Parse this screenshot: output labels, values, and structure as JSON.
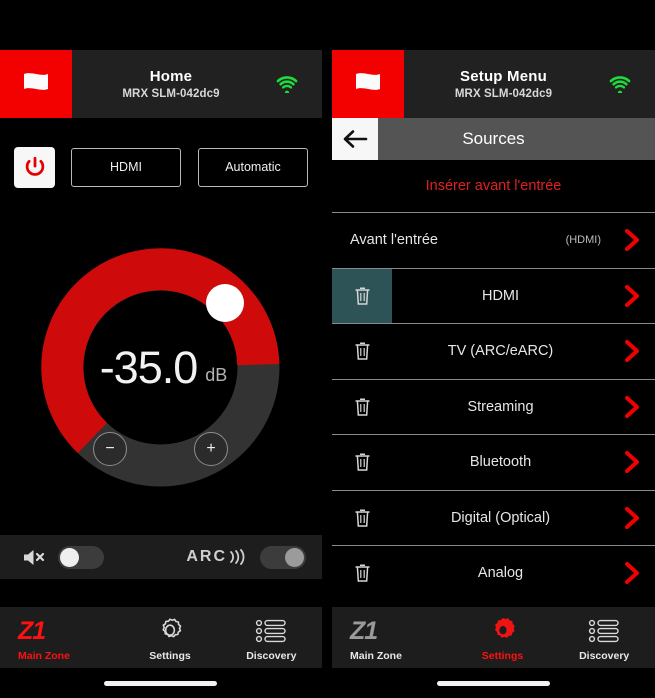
{
  "left": {
    "header": {
      "title": "Home",
      "subtitle": "MRX SLM-042dc9",
      "logo_icon": "flag-icon",
      "wifi_icon": "wifi-icon",
      "wifi_color": "#1ddb3a",
      "brand_color": "#f30000"
    },
    "controls": {
      "power_icon": "power-icon",
      "power_color": "#e40000",
      "source_button": "HDMI",
      "mode_button": "Automatic"
    },
    "dial": {
      "value": "-35.0",
      "unit": "dB",
      "minus_label": "−",
      "plus_label": "+",
      "arc_color": "#cf0a0a",
      "track_color": "#333333",
      "knob_color": "#ffffff",
      "percent": 62
    },
    "audio_bar": {
      "mute_icon": "speaker-mute-icon",
      "mute_state": "off",
      "arc_label": "ARC",
      "arc_icon": "arc-waves-icon",
      "arc_state": "on"
    },
    "tabs": [
      {
        "name": "zone",
        "icon": "z1-logo",
        "glyph": "Z1",
        "label": "Main Zone",
        "active": true
      },
      {
        "name": "settings",
        "icon": "gear-icon",
        "label": "Settings",
        "active": false
      },
      {
        "name": "discovery",
        "icon": "list-icon",
        "label": "Discovery",
        "active": false
      }
    ]
  },
  "right": {
    "header": {
      "title": "Setup Menu",
      "subtitle": "MRX SLM-042dc9",
      "logo_icon": "flag-icon",
      "wifi_icon": "wifi-icon",
      "wifi_color": "#1ddb3a",
      "brand_color": "#f30000"
    },
    "sub_header": {
      "back_icon": "arrow-left-icon",
      "title": "Sources"
    },
    "insert_hint": "Insérer avant l'entrée",
    "list_head": {
      "label": "Avant l'entrée",
      "tag": "(HDMI)",
      "chevron_icon": "chevron-right-icon"
    },
    "sources": [
      {
        "label": "HDMI",
        "trash_icon": "trash-icon",
        "trash_highlight": true,
        "chevron_icon": "chevron-right-icon"
      },
      {
        "label": "TV (ARC/eARC)",
        "trash_icon": "trash-icon",
        "trash_highlight": false,
        "chevron_icon": "chevron-right-icon"
      },
      {
        "label": "Streaming",
        "trash_icon": "trash-icon",
        "trash_highlight": false,
        "chevron_icon": "chevron-right-icon"
      },
      {
        "label": "Bluetooth",
        "trash_icon": "trash-icon",
        "trash_highlight": false,
        "chevron_icon": "chevron-right-icon"
      },
      {
        "label": "Digital (Optical)",
        "trash_icon": "trash-icon",
        "trash_highlight": false,
        "chevron_icon": "chevron-right-icon"
      },
      {
        "label": "Analog",
        "trash_icon": "trash-icon",
        "trash_highlight": false,
        "chevron_icon": "chevron-right-icon"
      }
    ],
    "tabs": [
      {
        "name": "zone",
        "icon": "z1-logo",
        "glyph": "Z1",
        "label": "Main Zone",
        "active": false
      },
      {
        "name": "settings",
        "icon": "gear-icon",
        "label": "Settings",
        "active": true
      },
      {
        "name": "discovery",
        "icon": "list-icon",
        "label": "Discovery",
        "active": false
      }
    ]
  },
  "colors": {
    "accent_red": "#ff1111",
    "brand_red": "#f30000",
    "highlight_teal": "#2d5356",
    "wifi_green": "#1ddb3a"
  }
}
